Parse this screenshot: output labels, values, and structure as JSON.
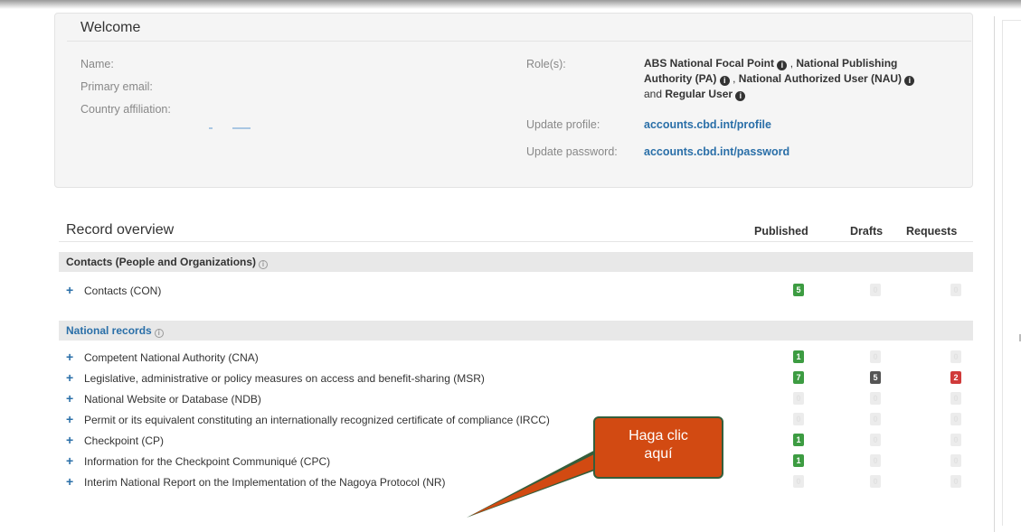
{
  "welcome": {
    "title": "Welcome",
    "name_label": "Name:",
    "email_label": "Primary email:",
    "country_label": "Country affiliation:",
    "roles_label": "Role(s):",
    "role1": "ABS National Focal Point",
    "role2a": "National Publishing",
    "role2b": "Authority (PA)",
    "role3": "National Authorized User (NAU)",
    "and_text": "and",
    "role4": "Regular User",
    "update_profile_label": "Update profile:",
    "update_profile_link": "accounts.cbd.int/profile",
    "update_password_label": "Update password:",
    "update_password_link": "accounts.cbd.int/password"
  },
  "overview": {
    "title": "Record overview",
    "col_published": "Published",
    "col_drafts": "Drafts",
    "col_requests": "Requests",
    "sections": [
      {
        "title": "Contacts (People and Organizations)",
        "rows": [
          {
            "label": "Contacts (CON)",
            "published": "5",
            "drafts": "0",
            "requests": "0"
          }
        ]
      },
      {
        "title": "National records",
        "rows": [
          {
            "label": "Competent National Authority (CNA)",
            "published": "1",
            "drafts": "0",
            "requests": "0"
          },
          {
            "label": "Legislative, administrative or policy measures on access and benefit-sharing (MSR)",
            "published": "7",
            "drafts": "5",
            "requests": "2"
          },
          {
            "label": "National Website or Database (NDB)",
            "published": "0",
            "drafts": "0",
            "requests": "0"
          },
          {
            "label": "Permit or its equivalent constituting an internationally recognized certificate of compliance (IRCC)",
            "published": "0",
            "drafts": "0",
            "requests": "0"
          },
          {
            "label": "Checkpoint (CP)",
            "published": "1",
            "drafts": "0",
            "requests": "0"
          },
          {
            "label": "Information for the Checkpoint Communiqué (CPC)",
            "published": "1",
            "drafts": "0",
            "requests": "0"
          },
          {
            "label": "Interim National Report on the Implementation of the Nagoya Protocol (NR)",
            "published": "0",
            "drafts": "0",
            "requests": "0"
          }
        ]
      }
    ]
  },
  "callout": {
    "line1": "Haga clic",
    "line2": "aquí"
  },
  "colors": {
    "published_badge": "#3d9c42",
    "drafts_badge": "#555555",
    "requests_badge": "#d03a3a",
    "link": "#2a6fa8",
    "callout": "#d24a12"
  }
}
